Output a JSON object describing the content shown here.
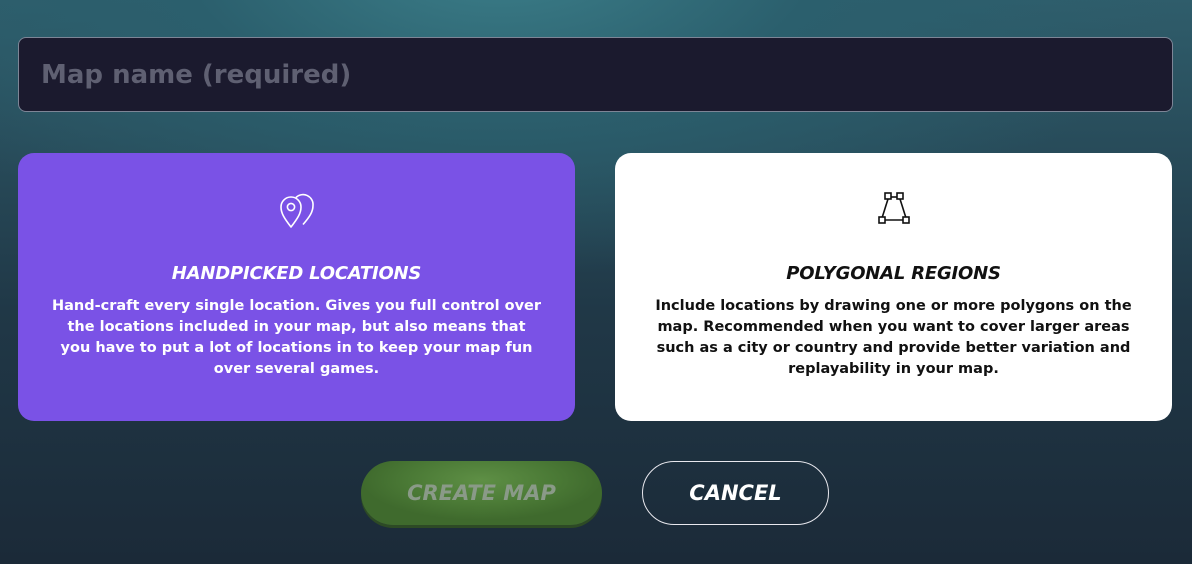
{
  "map_name_input": {
    "value": "",
    "placeholder": "Map name (required)"
  },
  "cards": {
    "handpicked": {
      "icon": "location-pins-icon",
      "title": "HANDPICKED LOCATIONS",
      "description": "Hand-craft every single location. Gives you full control over the locations included in your map, but also means that you have to put a lot of locations in to keep your map fun over several games."
    },
    "polygonal": {
      "icon": "polygon-icon",
      "title": "POLYGONAL REGIONS",
      "description": "Include locations by drawing one or more polygons on the map. Recommended when you want to cover larger areas such as a city or country and provide better variation and replayability in your map."
    }
  },
  "buttons": {
    "create": "CREATE MAP",
    "cancel": "CANCEL"
  },
  "colors": {
    "selected_card": "#7a52e6",
    "card": "#ffffff",
    "create_button": "#4b7a36",
    "input_background": "#1b1a2e"
  }
}
